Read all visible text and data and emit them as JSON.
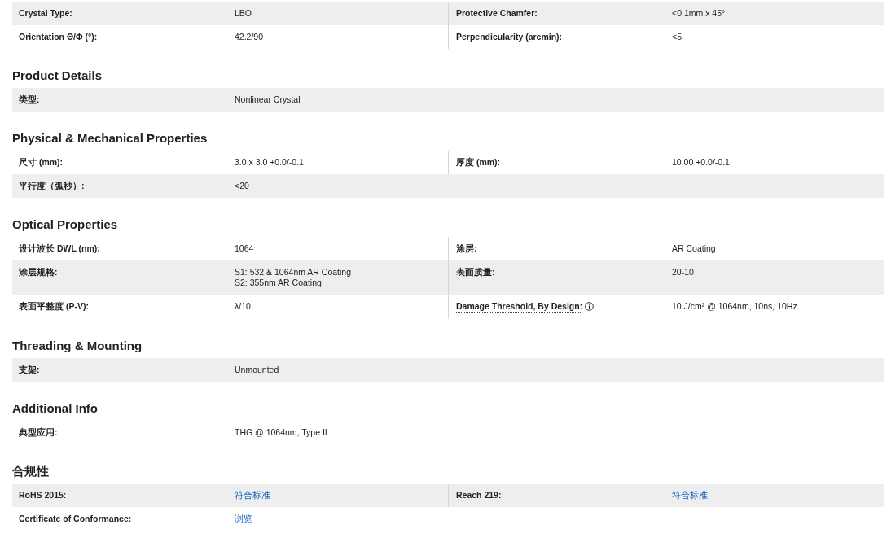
{
  "sections": [
    {
      "rows": [
        {
          "shaded": true,
          "cells": [
            {
              "label": "Crystal Type:",
              "value": [
                "LBO"
              ]
            },
            {
              "label": "Protective Chamfer:",
              "value": [
                "<0.1mm x 45°"
              ]
            }
          ]
        },
        {
          "shaded": false,
          "cells": [
            {
              "label": "Orientation Θ/Φ (°):",
              "value": [
                "42.2/90"
              ]
            },
            {
              "label": "Perpendicularity (arcmin):",
              "value": [
                "<5"
              ]
            }
          ]
        }
      ]
    },
    {
      "heading": "Product Details",
      "rows": [
        {
          "shaded": true,
          "cells": [
            {
              "label": "类型:",
              "value": [
                "Nonlinear Crystal"
              ]
            }
          ]
        }
      ]
    },
    {
      "heading": "Physical & Mechanical Properties",
      "rows": [
        {
          "shaded": false,
          "cells": [
            {
              "label": "尺寸 (mm):",
              "value": [
                "3.0 x 3.0 +0.0/-0.1"
              ]
            },
            {
              "label": "厚度 (mm):",
              "value": [
                "10.00 +0.0/-0.1"
              ]
            }
          ]
        },
        {
          "shaded": true,
          "cells": [
            {
              "label": "平行度（弧秒）:",
              "value": [
                "<20"
              ]
            }
          ]
        }
      ]
    },
    {
      "heading": "Optical Properties",
      "rows": [
        {
          "shaded": false,
          "cells": [
            {
              "label": "设计波长 DWL (nm):",
              "value": [
                "1064"
              ]
            },
            {
              "label": "涂层:",
              "value": [
                "AR Coating"
              ]
            }
          ]
        },
        {
          "shaded": true,
          "cells": [
            {
              "label": "涂层规格:",
              "value": [
                "S1: 532 & 1064nm AR Coating",
                "S2: 355nm AR Coating"
              ]
            },
            {
              "label": "表面质量:",
              "value": [
                "20-10"
              ]
            }
          ]
        },
        {
          "shaded": false,
          "cells": [
            {
              "label": "表面平整度 (P-V):",
              "value": [
                "λ/10"
              ]
            },
            {
              "label": "Damage Threshold, By Design:",
              "info": true,
              "value": [
                "10 J/cm² @ 1064nm, 10ns, 10Hz"
              ]
            }
          ]
        }
      ]
    },
    {
      "heading": "Threading & Mounting",
      "rows": [
        {
          "shaded": true,
          "cells": [
            {
              "label": "支架:",
              "value": [
                "Unmounted"
              ]
            }
          ]
        }
      ]
    },
    {
      "heading": "Additional Info",
      "rows": [
        {
          "shaded": false,
          "cells": [
            {
              "label": "典型应用:",
              "value": [
                "THG @ 1064nm, Type II"
              ]
            }
          ]
        }
      ]
    },
    {
      "heading": "合规性",
      "rows": [
        {
          "shaded": true,
          "cells": [
            {
              "label": "RoHS 2015:",
              "link": true,
              "value": [
                "符合标准"
              ]
            },
            {
              "label": "Reach 219:",
              "link": true,
              "value": [
                "符合标准"
              ]
            }
          ]
        },
        {
          "shaded": false,
          "cells": [
            {
              "label": "Certificate of Conformance:",
              "link": true,
              "value": [
                "浏览"
              ]
            }
          ]
        }
      ]
    }
  ]
}
